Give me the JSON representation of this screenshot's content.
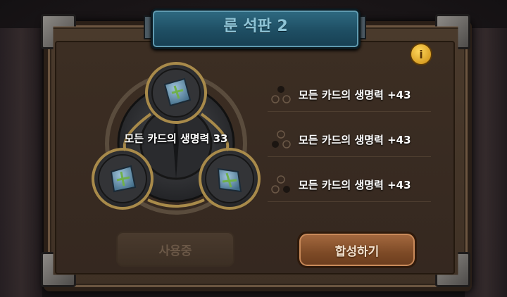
{
  "title": "룬 석판 2",
  "info_icon": "info-icon",
  "rune_board": {
    "center_label": "모든 카드의 생명력 33",
    "slot_icons": [
      "rune-stone-icon",
      "rune-stone-icon",
      "rune-stone-icon"
    ]
  },
  "stats": [
    {
      "text": "모든 카드의 생명력 +43",
      "dots_icon": "slot-dots-icon"
    },
    {
      "text": "모든 카드의 생명력 +43",
      "dots_icon": "slot-dots-icon"
    },
    {
      "text": "모든 카드의 생명력 +43",
      "dots_icon": "slot-dots-icon"
    }
  ],
  "buttons": {
    "in_use": "사용중",
    "synthesize": "합성하기"
  },
  "colors": {
    "title_plate": "#1e4e63",
    "title_text": "#8fc4d6",
    "synth_button": "#7d4a26",
    "panel": "#3c2e23"
  }
}
